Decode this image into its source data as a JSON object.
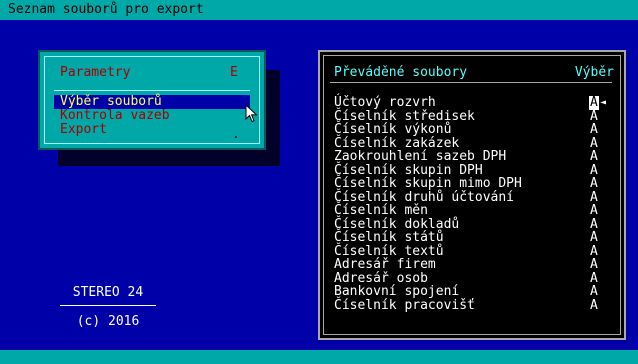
{
  "window": {
    "title": "Seznam souborů pro export"
  },
  "menu": {
    "title": "Parametry",
    "title_key": "E",
    "items": [
      {
        "label": "Výběr souborů",
        "selected": true
      },
      {
        "label": "Kontrola vazeb",
        "selected": false
      },
      {
        "label": "Export",
        "selected": false
      }
    ],
    "trailing_mark": "."
  },
  "brand": {
    "name": "STEREO 24",
    "copyright": "(c)  2016"
  },
  "files_panel": {
    "header_left": "Převáděné soubory",
    "header_right": "Výběr",
    "rows": [
      {
        "name": "Účtový rozvrh",
        "flag": "A",
        "active": true
      },
      {
        "name": "Číselník středisek",
        "flag": "A"
      },
      {
        "name": "Číselník výkonů",
        "flag": "A"
      },
      {
        "name": "Číselník zakázek",
        "flag": "A"
      },
      {
        "name": "Zaokrouhlení sazeb DPH",
        "flag": "A"
      },
      {
        "name": "Číselník skupin DPH",
        "flag": "A"
      },
      {
        "name": "Číselník skupin mimo DPH",
        "flag": "A"
      },
      {
        "name": "Číselník druhů účtování",
        "flag": "A"
      },
      {
        "name": "Číselník měn",
        "flag": "A"
      },
      {
        "name": "Číselník dokladů",
        "flag": "A"
      },
      {
        "name": "Číselník států",
        "flag": "A"
      },
      {
        "name": "Číselník textů",
        "flag": "A"
      },
      {
        "name": "Adresář firem",
        "flag": "A"
      },
      {
        "name": "Adresář osob",
        "flag": "A"
      },
      {
        "name": "Bankovní spojení",
        "flag": "A"
      },
      {
        "name": "Číselník pracovišť",
        "flag": "A"
      }
    ]
  },
  "colors": {
    "background": "#0000a8",
    "bar": "#00a8a8",
    "menu_text": "#a80000",
    "highlight_text": "#ffff55",
    "panel_header": "#55ffff"
  },
  "icons": {
    "cursor": "mouse-pointer-icon",
    "active_marker": "left-triangle-icon"
  }
}
